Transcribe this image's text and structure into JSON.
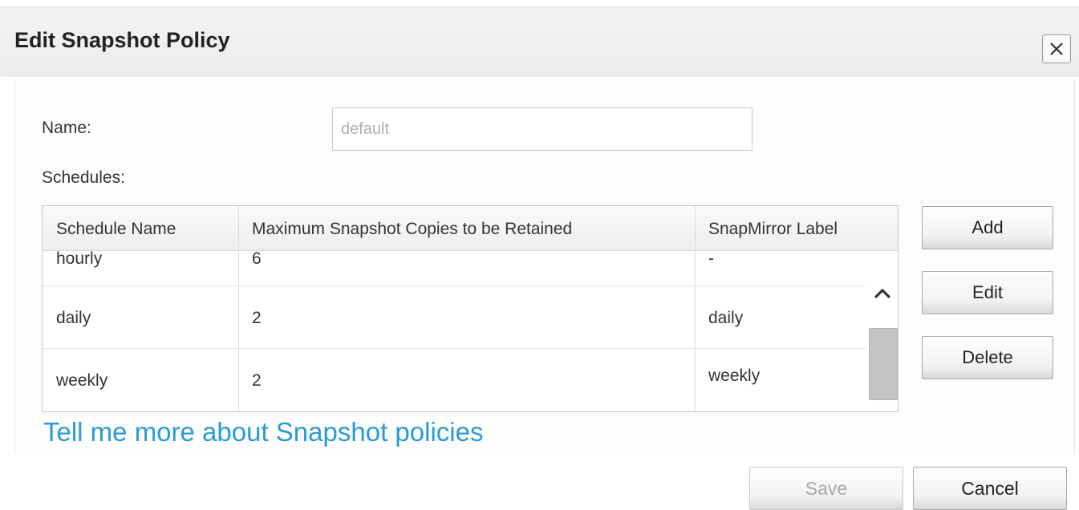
{
  "dialog": {
    "title": "Edit Snapshot Policy"
  },
  "form": {
    "name_label": "Name:",
    "name_value": "default",
    "schedules_label": "Schedules:"
  },
  "table": {
    "columns": [
      "Schedule Name",
      "Maximum Snapshot Copies to be Retained",
      "SnapMirror Label"
    ],
    "rows": [
      {
        "schedule": "hourly",
        "copies": "6",
        "label": "-"
      },
      {
        "schedule": "daily",
        "copies": "2",
        "label": "daily"
      },
      {
        "schedule": "weekly",
        "copies": "2",
        "label": "weekly"
      }
    ]
  },
  "actions": {
    "add": "Add",
    "edit": "Edit",
    "delete": "Delete"
  },
  "help_link": "Tell me more about Snapshot policies",
  "footer": {
    "save": "Save",
    "cancel": "Cancel"
  },
  "icons": {
    "close": "close-icon",
    "scroll_up": "chevron-up-icon"
  },
  "colors": {
    "link": "#2b9bd3",
    "disabled_text": "#a9a9a9"
  }
}
